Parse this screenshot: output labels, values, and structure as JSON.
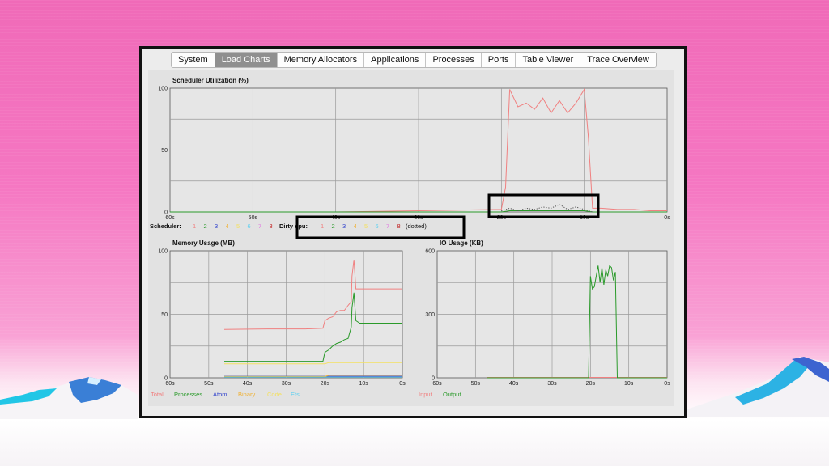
{
  "tabs": [
    {
      "label": "System",
      "active": false
    },
    {
      "label": "Load Charts",
      "active": true
    },
    {
      "label": "Memory Allocators",
      "active": false
    },
    {
      "label": "Applications",
      "active": false
    },
    {
      "label": "Processes",
      "active": false
    },
    {
      "label": "Ports",
      "active": false
    },
    {
      "label": "Table Viewer",
      "active": false
    },
    {
      "label": "Trace Overview",
      "active": false
    }
  ],
  "scheduler_legend": {
    "label": "Scheduler:",
    "items": [
      {
        "text": "1",
        "color": "#f08080"
      },
      {
        "text": "2",
        "color": "#2a9a2a"
      },
      {
        "text": "3",
        "color": "#3344cc"
      },
      {
        "text": "4",
        "color": "#f0b030"
      },
      {
        "text": "5",
        "color": "#f4e060"
      },
      {
        "text": "6",
        "color": "#60d0f0"
      },
      {
        "text": "7",
        "color": "#e070e0"
      },
      {
        "text": "8",
        "color": "#c02020"
      }
    ]
  },
  "dirty_legend": {
    "label": "Dirty cpu:",
    "items": [
      {
        "text": "1",
        "color": "#f08080"
      },
      {
        "text": "2",
        "color": "#2a9a2a"
      },
      {
        "text": "3",
        "color": "#3344cc"
      },
      {
        "text": "4",
        "color": "#f0b030"
      },
      {
        "text": "5",
        "color": "#f4e060"
      },
      {
        "text": "6",
        "color": "#60d0f0"
      },
      {
        "text": "7",
        "color": "#e070e0"
      },
      {
        "text": "8",
        "color": "#c02020"
      }
    ],
    "suffix": "(dotted)"
  },
  "memory_legend": [
    {
      "text": "Total",
      "color": "#f08080"
    },
    {
      "text": "Processes",
      "color": "#2a9a2a"
    },
    {
      "text": "Atom",
      "color": "#3344cc"
    },
    {
      "text": "Binary",
      "color": "#f0b030"
    },
    {
      "text": "Code",
      "color": "#f4e060"
    },
    {
      "text": "Ets",
      "color": "#60d0f0"
    }
  ],
  "io_legend": [
    {
      "text": "Input",
      "color": "#f08080"
    },
    {
      "text": "Output",
      "color": "#2a9a2a"
    }
  ],
  "chart_data": [
    {
      "type": "line",
      "title": "Scheduler Utilization (%)",
      "xticks": [
        "60s",
        "50s",
        "40s",
        "30s",
        "20s",
        "10s",
        "0s"
      ],
      "yticks": [
        "100",
        "50",
        "0"
      ],
      "xlim": [
        60,
        0
      ],
      "ylim": [
        0,
        100
      ],
      "grid": true,
      "series": [
        {
          "name": "1",
          "color": "#f08080",
          "style": "solid",
          "x": [
            60,
            40,
            30,
            20,
            19.5,
            19,
            18,
            17,
            16,
            15,
            14,
            13,
            12,
            11,
            10,
            9.5,
            9,
            8,
            6,
            4,
            2,
            0
          ],
          "y": [
            0,
            0,
            1,
            2,
            20,
            99,
            85,
            88,
            83,
            92,
            80,
            90,
            80,
            88,
            99,
            60,
            3,
            3,
            2,
            2,
            1,
            1
          ]
        },
        {
          "name": "2",
          "color": "#2a9a2a",
          "style": "solid",
          "x": [
            60,
            50,
            40,
            30,
            20,
            19,
            10,
            9,
            5,
            0
          ],
          "y": [
            0,
            0,
            0,
            0,
            0,
            1,
            1,
            0,
            0,
            0
          ]
        },
        {
          "name": "1",
          "color": "#555555",
          "style": "dotted",
          "x": [
            20,
            19,
            18,
            17,
            16,
            15,
            14,
            13,
            12,
            11,
            10,
            9
          ],
          "y": [
            1,
            3,
            1,
            3,
            2,
            4,
            3,
            6,
            2,
            4,
            2,
            0
          ]
        }
      ]
    },
    {
      "type": "line",
      "title": "Memory Usage (MB)",
      "xticks": [
        "60s",
        "50s",
        "40s",
        "30s",
        "20s",
        "10s",
        "0s"
      ],
      "yticks": [
        "100",
        "50",
        "0"
      ],
      "xlim": [
        60,
        0
      ],
      "ylim": [
        0,
        100
      ],
      "grid": true,
      "series": [
        {
          "name": "Total",
          "color": "#f08080",
          "x": [
            46,
            35,
            25,
            20.5,
            20,
            19,
            18,
            17,
            16,
            15,
            14,
            13.2,
            13,
            12.5,
            12,
            11,
            10,
            0
          ],
          "y": [
            38,
            38.5,
            38.5,
            39,
            45,
            47,
            48,
            52,
            53,
            53,
            57,
            60,
            80,
            93,
            70,
            70,
            70,
            70
          ]
        },
        {
          "name": "Processes",
          "color": "#2a9a2a",
          "x": [
            46,
            35,
            25,
            20.5,
            20,
            19,
            18,
            17,
            16,
            15,
            14,
            13.2,
            13,
            12.5,
            12,
            11,
            0
          ],
          "y": [
            13,
            13,
            13,
            13,
            20,
            22,
            25,
            27,
            28,
            30,
            31,
            40,
            55,
            67,
            45,
            43,
            43
          ]
        },
        {
          "name": "Atom",
          "color": "#3344cc",
          "x": [
            46,
            0
          ],
          "y": [
            1.2,
            1.2
          ]
        },
        {
          "name": "Binary",
          "color": "#f0b030",
          "x": [
            46,
            20,
            19,
            0
          ],
          "y": [
            1,
            1,
            2,
            2
          ]
        },
        {
          "name": "Code",
          "color": "#f4e060",
          "x": [
            46,
            20,
            19,
            0
          ],
          "y": [
            11,
            11,
            12,
            12
          ]
        },
        {
          "name": "Ets",
          "color": "#60d0f0",
          "x": [
            46,
            0
          ],
          "y": [
            0.6,
            0.6
          ]
        }
      ]
    },
    {
      "type": "line",
      "title": "IO Usage (KB)",
      "xticks": [
        "60s",
        "50s",
        "40s",
        "30s",
        "20s",
        "10s",
        "0s"
      ],
      "yticks": [
        "600",
        "300",
        "0"
      ],
      "xlim": [
        60,
        0
      ],
      "ylim": [
        0,
        600
      ],
      "grid": true,
      "series": [
        {
          "name": "Input",
          "color": "#f08080",
          "x": [
            47,
            0
          ],
          "y": [
            2,
            2
          ]
        },
        {
          "name": "Output",
          "color": "#2a9a2a",
          "x": [
            47,
            20.5,
            20,
            19.5,
            19,
            18,
            17.5,
            17,
            16.5,
            16,
            15.5,
            15,
            14.5,
            14,
            13.5,
            13,
            12.5,
            12,
            0
          ],
          "y": [
            0,
            0,
            480,
            420,
            430,
            530,
            450,
            520,
            440,
            510,
            480,
            530,
            520,
            460,
            500,
            0,
            0,
            0,
            0
          ]
        }
      ]
    }
  ]
}
